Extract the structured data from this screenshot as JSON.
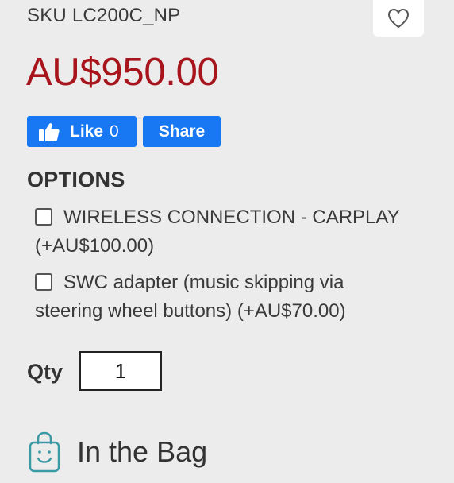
{
  "product": {
    "sku": "SKU LC200C_NP",
    "price": "AU$950.00"
  },
  "colors": {
    "price": "#a8141b",
    "facebook": "#1877f2",
    "bag_icon": "#3a9aa6",
    "background": "#ececec"
  },
  "wishlist": {
    "icon": "heart-outline-icon"
  },
  "social": {
    "like_label": "Like",
    "like_count": "0",
    "share_label": "Share",
    "like_icon": "thumbs-up-icon"
  },
  "options": {
    "heading": "OPTIONS",
    "items": [
      {
        "label": "WIRELESS CONNECTION - CARPLAY (+AU$100.00)",
        "checked": false
      },
      {
        "label": "SWC adapter (music skipping via steering wheel buttons) (+AU$70.00)",
        "checked": false
      }
    ]
  },
  "quantity": {
    "label": "Qty",
    "value": "1"
  },
  "bag": {
    "label": "In the Bag",
    "icon": "shopping-bag-icon"
  }
}
